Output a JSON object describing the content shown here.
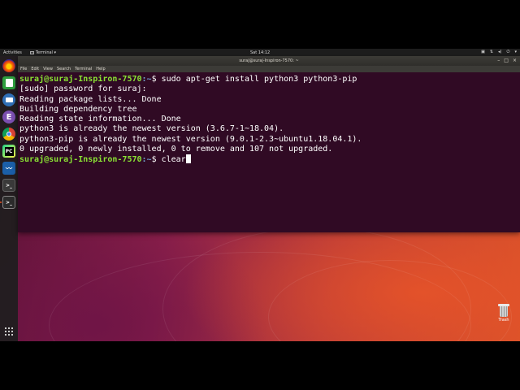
{
  "top_panel": {
    "activities": "Activities",
    "app_menu": "Terminal ▾",
    "clock": "Sat 14:12",
    "tray_icons": [
      "video-icon",
      "network-icon",
      "volume-icon",
      "power-icon",
      "menu-arrow-icon"
    ]
  },
  "launcher": {
    "items": [
      {
        "name": "firefox",
        "glyph": "",
        "color": "#e66000"
      },
      {
        "name": "libreoffice-calc",
        "glyph": "",
        "color": "#2e9e3e"
      },
      {
        "name": "thunderbird",
        "glyph": "",
        "color": "#2f6fb5"
      },
      {
        "name": "emacs",
        "glyph": "E",
        "color": "#7b4fb0"
      },
      {
        "name": "chrome",
        "glyph": "",
        "color": "#e0e0e0"
      },
      {
        "name": "pycharm",
        "glyph": "PC",
        "color": "#1c1c1c"
      },
      {
        "name": "wireshark",
        "glyph": "",
        "color": "#1b5fa8"
      },
      {
        "name": "terminal-secondary",
        "glyph": ">_",
        "color": "#3a3a3a"
      },
      {
        "name": "terminal",
        "glyph": ">_",
        "color": "#2c2c2c"
      }
    ]
  },
  "terminal": {
    "title": "suraj@suraj-Inspiron-7570: ~",
    "menu": [
      "File",
      "Edit",
      "View",
      "Search",
      "Terminal",
      "Help"
    ],
    "prompt_user": "suraj@suraj-Inspiron-7570",
    "prompt_path": ":~",
    "lines": [
      {
        "type": "cmd",
        "text": "$ sudo apt-get install python3 python3-pip"
      },
      {
        "type": "out",
        "text": "[sudo] password for suraj:"
      },
      {
        "type": "out",
        "text": "Reading package lists... Done"
      },
      {
        "type": "out",
        "text": "Building dependency tree"
      },
      {
        "type": "out",
        "text": "Reading state information... Done"
      },
      {
        "type": "out",
        "text": "python3 is already the newest version (3.6.7-1~18.04)."
      },
      {
        "type": "out",
        "text": "python3-pip is already the newest version (9.0.1-2.3~ubuntu1.18.04.1)."
      },
      {
        "type": "out",
        "text": "0 upgraded, 0 newly installed, 0 to remove and 107 not upgraded."
      },
      {
        "type": "cmd",
        "text": "$ clear"
      }
    ]
  },
  "desktop": {
    "trash_label": "Trash"
  }
}
